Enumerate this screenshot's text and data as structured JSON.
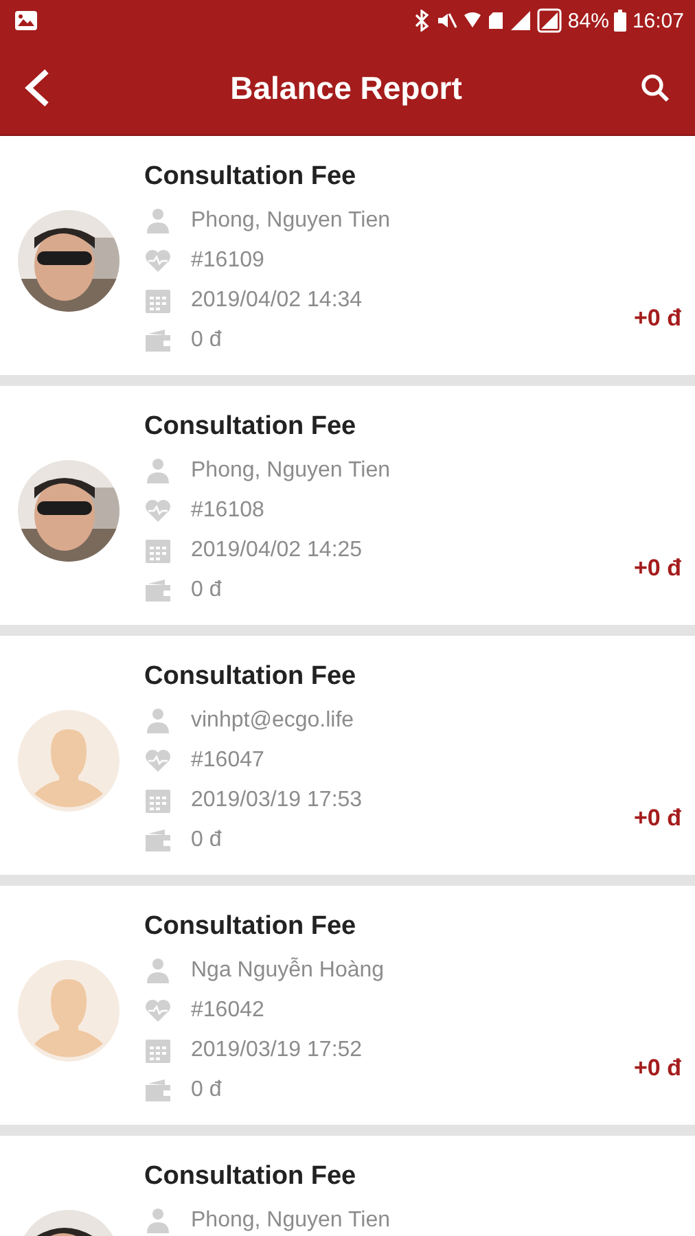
{
  "status_bar": {
    "battery": "84%",
    "time": "16:07"
  },
  "app_bar": {
    "title": "Balance Report"
  },
  "entries": [
    {
      "title": "Consultation Fee",
      "name": "Phong, Nguyen Tien",
      "id": "#16109",
      "datetime": "2019/04/02 14:34",
      "balance": "0 đ",
      "amount": "+0 đ"
    },
    {
      "title": "Consultation Fee",
      "name": "Phong, Nguyen Tien",
      "id": "#16108",
      "datetime": "2019/04/02 14:25",
      "balance": "0 đ",
      "amount": "+0 đ"
    },
    {
      "title": "Consultation Fee",
      "avatar": {
        "kind": "default"
      },
      "name": "vinhpt@ecgo.life",
      "id": "#16047",
      "datetime": "2019/03/19 17:53",
      "balance": "0 đ",
      "amount": "+0 đ"
    },
    {
      "title": "Consultation Fee",
      "avatar": {
        "kind": "default"
      },
      "name": "Nga Nguyễn Hoàng",
      "id": "#16042",
      "datetime": "2019/03/19 17:52",
      "balance": "0 đ",
      "amount": "+0 đ"
    },
    {
      "title": "Consultation Fee",
      "name": "Phong, Nguyen Tien"
    }
  ]
}
